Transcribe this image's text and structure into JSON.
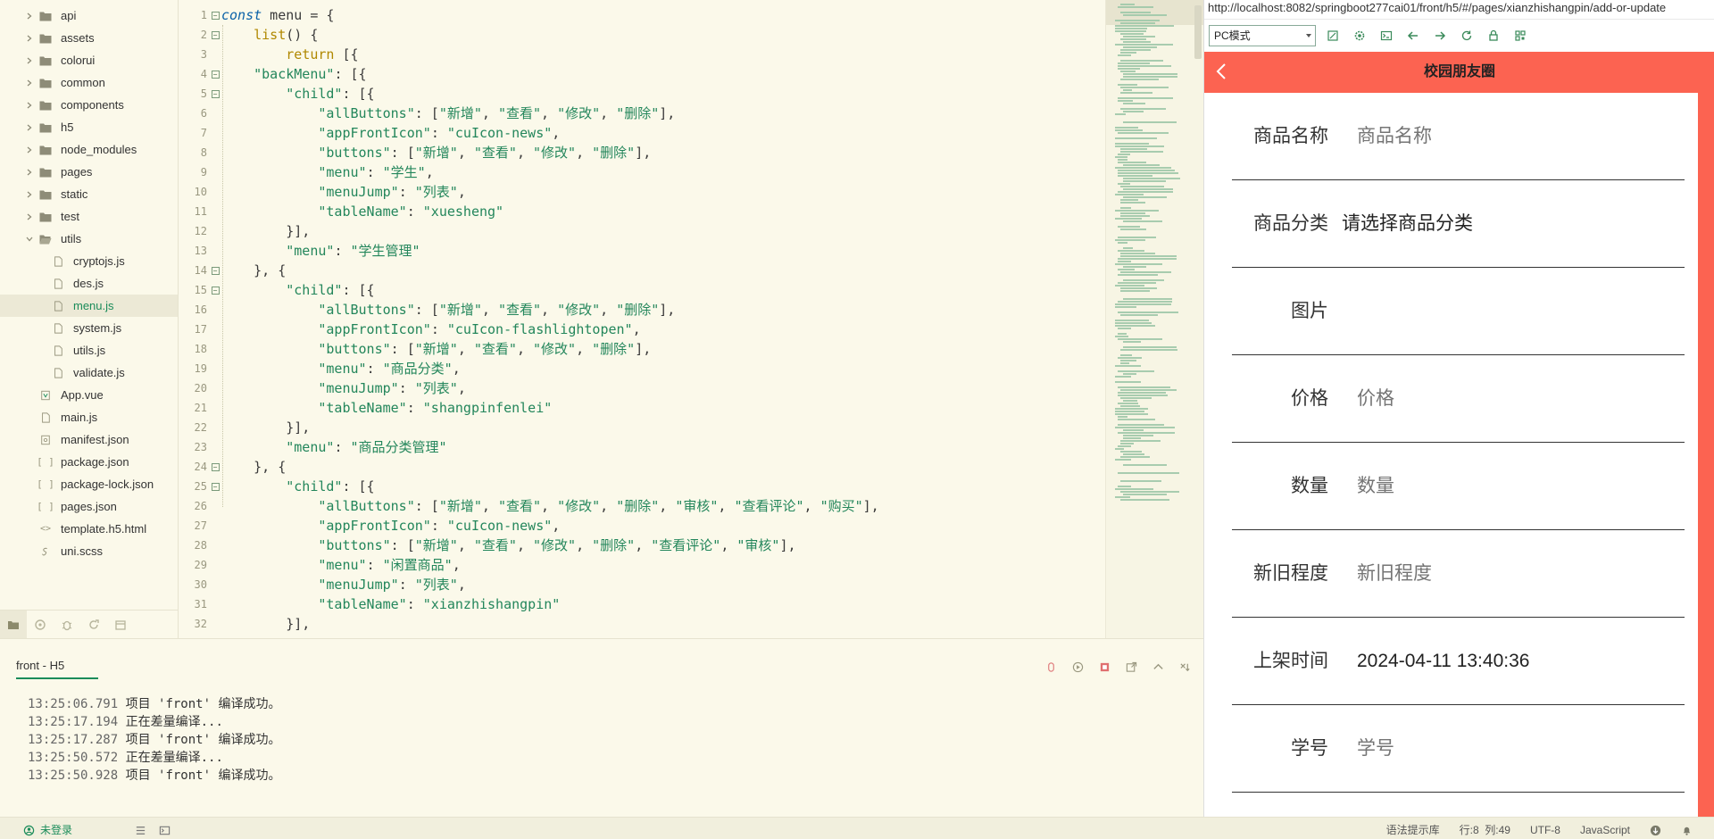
{
  "sidebar": {
    "tree": [
      {
        "label": "api",
        "type": "folder",
        "state": "collapsed",
        "indent": 0
      },
      {
        "label": "assets",
        "type": "folder",
        "state": "collapsed",
        "indent": 0
      },
      {
        "label": "colorui",
        "type": "folder",
        "state": "collapsed",
        "indent": 0
      },
      {
        "label": "common",
        "type": "folder",
        "state": "collapsed",
        "indent": 0
      },
      {
        "label": "components",
        "type": "folder",
        "state": "collapsed",
        "indent": 0
      },
      {
        "label": "h5",
        "type": "folder",
        "state": "collapsed",
        "indent": 0
      },
      {
        "label": "node_modules",
        "type": "folder",
        "state": "collapsed",
        "indent": 0
      },
      {
        "label": "pages",
        "type": "folder",
        "state": "collapsed",
        "indent": 0
      },
      {
        "label": "static",
        "type": "folder",
        "state": "collapsed",
        "indent": 0
      },
      {
        "label": "test",
        "type": "folder",
        "state": "collapsed",
        "indent": 0
      },
      {
        "label": "utils",
        "type": "folder",
        "state": "expanded",
        "indent": 0
      },
      {
        "label": "cryptojs.js",
        "type": "file",
        "indent": 1
      },
      {
        "label": "des.js",
        "type": "file",
        "indent": 1
      },
      {
        "label": "menu.js",
        "type": "file",
        "indent": 1,
        "active": true
      },
      {
        "label": "system.js",
        "type": "file",
        "indent": 1
      },
      {
        "label": "utils.js",
        "type": "file",
        "indent": 1
      },
      {
        "label": "validate.js",
        "type": "file",
        "indent": 1
      },
      {
        "label": "App.vue",
        "type": "vue",
        "indent": 0
      },
      {
        "label": "main.js",
        "type": "file",
        "indent": 0
      },
      {
        "label": "manifest.json",
        "type": "manifest",
        "indent": 0
      },
      {
        "label": "package.json",
        "type": "json",
        "indent": 0
      },
      {
        "label": "package-lock.json",
        "type": "json",
        "indent": 0
      },
      {
        "label": "pages.json",
        "type": "json",
        "indent": 0
      },
      {
        "label": "template.h5.html",
        "type": "html",
        "indent": 0
      },
      {
        "label": "uni.scss",
        "type": "scss",
        "indent": 0
      }
    ],
    "bottom_tabs": [
      "folder-icon",
      "plugin-icon",
      "debug-icon",
      "refresh-icon",
      "package-icon"
    ]
  },
  "editor": {
    "lines": [
      {
        "n": "1",
        "fold": "⊟",
        "tokens": [
          {
            "t": "const",
            "c": "kw"
          },
          {
            "t": " menu = {",
            "c": ""
          }
        ]
      },
      {
        "n": "2",
        "fold": "⊟",
        "tokens": [
          {
            "t": "    ",
            "c": ""
          },
          {
            "t": "list",
            "c": "fn"
          },
          {
            "t": "() {",
            "c": ""
          }
        ]
      },
      {
        "n": "3",
        "fold": "",
        "tokens": [
          {
            "t": "        ",
            "c": ""
          },
          {
            "t": "return",
            "c": "ret"
          },
          {
            "t": " [{",
            "c": ""
          }
        ]
      },
      {
        "n": "4",
        "fold": "⊟",
        "tokens": [
          {
            "t": "    ",
            "c": ""
          },
          {
            "t": "\"backMenu\"",
            "c": "key"
          },
          {
            "t": ": [{",
            "c": ""
          }
        ]
      },
      {
        "n": "5",
        "fold": "⊟",
        "tokens": [
          {
            "t": "        ",
            "c": ""
          },
          {
            "t": "\"child\"",
            "c": "key"
          },
          {
            "t": ": [{",
            "c": ""
          }
        ]
      },
      {
        "n": "6",
        "fold": "",
        "tokens": [
          {
            "t": "            ",
            "c": ""
          },
          {
            "t": "\"allButtons\"",
            "c": "key"
          },
          {
            "t": ": [",
            "c": ""
          },
          {
            "t": "\"新增\"",
            "c": "str"
          },
          {
            "t": ", ",
            "c": ""
          },
          {
            "t": "\"查看\"",
            "c": "str"
          },
          {
            "t": ", ",
            "c": ""
          },
          {
            "t": "\"修改\"",
            "c": "str"
          },
          {
            "t": ", ",
            "c": ""
          },
          {
            "t": "\"删除\"",
            "c": "str"
          },
          {
            "t": "],",
            "c": ""
          }
        ]
      },
      {
        "n": "7",
        "fold": "",
        "tokens": [
          {
            "t": "            ",
            "c": ""
          },
          {
            "t": "\"appFrontIcon\"",
            "c": "key"
          },
          {
            "t": ": ",
            "c": ""
          },
          {
            "t": "\"cuIcon-news\"",
            "c": "str"
          },
          {
            "t": ",",
            "c": ""
          }
        ]
      },
      {
        "n": "8",
        "fold": "",
        "tokens": [
          {
            "t": "            ",
            "c": ""
          },
          {
            "t": "\"buttons\"",
            "c": "key"
          },
          {
            "t": ": [",
            "c": ""
          },
          {
            "t": "\"新增\"",
            "c": "str"
          },
          {
            "t": ", ",
            "c": ""
          },
          {
            "t": "\"查看\"",
            "c": "str"
          },
          {
            "t": ", ",
            "c": ""
          },
          {
            "t": "\"修改\"",
            "c": "str"
          },
          {
            "t": ", ",
            "c": ""
          },
          {
            "t": "\"删除\"",
            "c": "str"
          },
          {
            "t": "],",
            "c": ""
          }
        ]
      },
      {
        "n": "9",
        "fold": "",
        "tokens": [
          {
            "t": "            ",
            "c": ""
          },
          {
            "t": "\"menu\"",
            "c": "key"
          },
          {
            "t": ": ",
            "c": ""
          },
          {
            "t": "\"学生\"",
            "c": "str"
          },
          {
            "t": ",",
            "c": ""
          }
        ]
      },
      {
        "n": "10",
        "fold": "",
        "tokens": [
          {
            "t": "            ",
            "c": ""
          },
          {
            "t": "\"menuJump\"",
            "c": "key"
          },
          {
            "t": ": ",
            "c": ""
          },
          {
            "t": "\"列表\"",
            "c": "str"
          },
          {
            "t": ",",
            "c": ""
          }
        ]
      },
      {
        "n": "11",
        "fold": "",
        "tokens": [
          {
            "t": "            ",
            "c": ""
          },
          {
            "t": "\"tableName\"",
            "c": "key"
          },
          {
            "t": ": ",
            "c": ""
          },
          {
            "t": "\"xuesheng\"",
            "c": "str"
          }
        ]
      },
      {
        "n": "12",
        "fold": "",
        "tokens": [
          {
            "t": "        }],",
            "c": ""
          }
        ]
      },
      {
        "n": "13",
        "fold": "",
        "tokens": [
          {
            "t": "        ",
            "c": ""
          },
          {
            "t": "\"menu\"",
            "c": "key"
          },
          {
            "t": ": ",
            "c": ""
          },
          {
            "t": "\"学生管理\"",
            "c": "str"
          }
        ]
      },
      {
        "n": "14",
        "fold": "⊟",
        "tokens": [
          {
            "t": "    }, {",
            "c": ""
          }
        ]
      },
      {
        "n": "15",
        "fold": "⊟",
        "tokens": [
          {
            "t": "        ",
            "c": ""
          },
          {
            "t": "\"child\"",
            "c": "key"
          },
          {
            "t": ": [{",
            "c": ""
          }
        ]
      },
      {
        "n": "16",
        "fold": "",
        "tokens": [
          {
            "t": "            ",
            "c": ""
          },
          {
            "t": "\"allButtons\"",
            "c": "key"
          },
          {
            "t": ": [",
            "c": ""
          },
          {
            "t": "\"新增\"",
            "c": "str"
          },
          {
            "t": ", ",
            "c": ""
          },
          {
            "t": "\"查看\"",
            "c": "str"
          },
          {
            "t": ", ",
            "c": ""
          },
          {
            "t": "\"修改\"",
            "c": "str"
          },
          {
            "t": ", ",
            "c": ""
          },
          {
            "t": "\"删除\"",
            "c": "str"
          },
          {
            "t": "],",
            "c": ""
          }
        ]
      },
      {
        "n": "17",
        "fold": "",
        "tokens": [
          {
            "t": "            ",
            "c": ""
          },
          {
            "t": "\"appFrontIcon\"",
            "c": "key"
          },
          {
            "t": ": ",
            "c": ""
          },
          {
            "t": "\"cuIcon-flashlightopen\"",
            "c": "str"
          },
          {
            "t": ",",
            "c": ""
          }
        ]
      },
      {
        "n": "18",
        "fold": "",
        "tokens": [
          {
            "t": "            ",
            "c": ""
          },
          {
            "t": "\"buttons\"",
            "c": "key"
          },
          {
            "t": ": [",
            "c": ""
          },
          {
            "t": "\"新增\"",
            "c": "str"
          },
          {
            "t": ", ",
            "c": ""
          },
          {
            "t": "\"查看\"",
            "c": "str"
          },
          {
            "t": ", ",
            "c": ""
          },
          {
            "t": "\"修改\"",
            "c": "str"
          },
          {
            "t": ", ",
            "c": ""
          },
          {
            "t": "\"删除\"",
            "c": "str"
          },
          {
            "t": "],",
            "c": ""
          }
        ]
      },
      {
        "n": "19",
        "fold": "",
        "tokens": [
          {
            "t": "            ",
            "c": ""
          },
          {
            "t": "\"menu\"",
            "c": "key"
          },
          {
            "t": ": ",
            "c": ""
          },
          {
            "t": "\"商品分类\"",
            "c": "str"
          },
          {
            "t": ",",
            "c": ""
          }
        ]
      },
      {
        "n": "20",
        "fold": "",
        "tokens": [
          {
            "t": "            ",
            "c": ""
          },
          {
            "t": "\"menuJump\"",
            "c": "key"
          },
          {
            "t": ": ",
            "c": ""
          },
          {
            "t": "\"列表\"",
            "c": "str"
          },
          {
            "t": ",",
            "c": ""
          }
        ]
      },
      {
        "n": "21",
        "fold": "",
        "tokens": [
          {
            "t": "            ",
            "c": ""
          },
          {
            "t": "\"tableName\"",
            "c": "key"
          },
          {
            "t": ": ",
            "c": ""
          },
          {
            "t": "\"shangpinfenlei\"",
            "c": "str"
          }
        ]
      },
      {
        "n": "22",
        "fold": "",
        "tokens": [
          {
            "t": "        }],",
            "c": ""
          }
        ]
      },
      {
        "n": "23",
        "fold": "",
        "tokens": [
          {
            "t": "        ",
            "c": ""
          },
          {
            "t": "\"menu\"",
            "c": "key"
          },
          {
            "t": ": ",
            "c": ""
          },
          {
            "t": "\"商品分类管理\"",
            "c": "str"
          }
        ]
      },
      {
        "n": "24",
        "fold": "⊟",
        "tokens": [
          {
            "t": "    }, {",
            "c": ""
          }
        ]
      },
      {
        "n": "25",
        "fold": "⊟",
        "tokens": [
          {
            "t": "        ",
            "c": ""
          },
          {
            "t": "\"child\"",
            "c": "key"
          },
          {
            "t": ": [{",
            "c": ""
          }
        ]
      },
      {
        "n": "26",
        "fold": "",
        "tokens": [
          {
            "t": "            ",
            "c": ""
          },
          {
            "t": "\"allButtons\"",
            "c": "key"
          },
          {
            "t": ": [",
            "c": ""
          },
          {
            "t": "\"新增\"",
            "c": "str"
          },
          {
            "t": ", ",
            "c": ""
          },
          {
            "t": "\"查看\"",
            "c": "str"
          },
          {
            "t": ", ",
            "c": ""
          },
          {
            "t": "\"修改\"",
            "c": "str"
          },
          {
            "t": ", ",
            "c": ""
          },
          {
            "t": "\"删除\"",
            "c": "str"
          },
          {
            "t": ", ",
            "c": ""
          },
          {
            "t": "\"审核\"",
            "c": "str"
          },
          {
            "t": ", ",
            "c": ""
          },
          {
            "t": "\"查看评论\"",
            "c": "str"
          },
          {
            "t": ", ",
            "c": ""
          },
          {
            "t": "\"购买\"",
            "c": "str"
          },
          {
            "t": "],",
            "c": ""
          }
        ]
      },
      {
        "n": "27",
        "fold": "",
        "tokens": [
          {
            "t": "            ",
            "c": ""
          },
          {
            "t": "\"appFrontIcon\"",
            "c": "key"
          },
          {
            "t": ": ",
            "c": ""
          },
          {
            "t": "\"cuIcon-news\"",
            "c": "str"
          },
          {
            "t": ",",
            "c": ""
          }
        ]
      },
      {
        "n": "28",
        "fold": "",
        "tokens": [
          {
            "t": "            ",
            "c": ""
          },
          {
            "t": "\"buttons\"",
            "c": "key"
          },
          {
            "t": ": [",
            "c": ""
          },
          {
            "t": "\"新增\"",
            "c": "str"
          },
          {
            "t": ", ",
            "c": ""
          },
          {
            "t": "\"查看\"",
            "c": "str"
          },
          {
            "t": ", ",
            "c": ""
          },
          {
            "t": "\"修改\"",
            "c": "str"
          },
          {
            "t": ", ",
            "c": ""
          },
          {
            "t": "\"删除\"",
            "c": "str"
          },
          {
            "t": ", ",
            "c": ""
          },
          {
            "t": "\"查看评论\"",
            "c": "str"
          },
          {
            "t": ", ",
            "c": ""
          },
          {
            "t": "\"审核\"",
            "c": "str"
          },
          {
            "t": "],",
            "c": ""
          }
        ]
      },
      {
        "n": "29",
        "fold": "",
        "tokens": [
          {
            "t": "            ",
            "c": ""
          },
          {
            "t": "\"menu\"",
            "c": "key"
          },
          {
            "t": ": ",
            "c": ""
          },
          {
            "t": "\"闲置商品\"",
            "c": "str"
          },
          {
            "t": ",",
            "c": ""
          }
        ]
      },
      {
        "n": "30",
        "fold": "",
        "tokens": [
          {
            "t": "            ",
            "c": ""
          },
          {
            "t": "\"menuJump\"",
            "c": "key"
          },
          {
            "t": ": ",
            "c": ""
          },
          {
            "t": "\"列表\"",
            "c": "str"
          },
          {
            "t": ",",
            "c": ""
          }
        ]
      },
      {
        "n": "31",
        "fold": "",
        "tokens": [
          {
            "t": "            ",
            "c": ""
          },
          {
            "t": "\"tableName\"",
            "c": "key"
          },
          {
            "t": ": ",
            "c": ""
          },
          {
            "t": "\"xianzhishangpin\"",
            "c": "str"
          }
        ]
      },
      {
        "n": "32",
        "fold": "",
        "tokens": [
          {
            "t": "        }],",
            "c": ""
          }
        ]
      }
    ]
  },
  "console": {
    "tab_label": "front - H5",
    "tools": [
      "stop-icon",
      "run-icon",
      "square-stop-icon",
      "open-external-icon",
      "chevron-up-icon",
      "clear-icon"
    ],
    "log": [
      {
        "time": "13:25:06.791",
        "msg": "项目 'front' 编译成功。"
      },
      {
        "time": "13:25:17.194",
        "msg": "正在差量编译..."
      },
      {
        "time": "13:25:17.287",
        "msg": "项目 'front' 编译成功。"
      },
      {
        "time": "13:25:50.572",
        "msg": "正在差量编译..."
      },
      {
        "time": "13:25:50.928",
        "msg": "项目 'front' 编译成功。"
      }
    ]
  },
  "statusbar": {
    "login": "未登录",
    "syntax_hint": "语法提示库",
    "position": "行:8  列:49",
    "encoding": "UTF-8",
    "language": "JavaScript"
  },
  "preview": {
    "url": "http://localhost:8082/springboot277cai01/front/h5/#/pages/xianzhishangpin/add-or-update",
    "mode": "PC模式",
    "page_title": "校园朋友圈",
    "accent_color": "#fc6351",
    "fields": [
      {
        "label": "商品名称",
        "placeholder": "商品名称",
        "value": "",
        "kind": "input"
      },
      {
        "label": "商品分类",
        "placeholder": "",
        "value": "请选择商品分类",
        "kind": "select"
      },
      {
        "label": "图片",
        "placeholder": "",
        "value": "",
        "kind": "image"
      },
      {
        "label": "价格",
        "placeholder": "价格",
        "value": "",
        "kind": "input"
      },
      {
        "label": "数量",
        "placeholder": "数量",
        "value": "",
        "kind": "input"
      },
      {
        "label": "新旧程度",
        "placeholder": "新旧程度",
        "value": "",
        "kind": "input"
      },
      {
        "label": "上架时间",
        "placeholder": "",
        "value": "2024-04-11 13:40:36",
        "kind": "datetime"
      },
      {
        "label": "学号",
        "placeholder": "学号",
        "value": "",
        "kind": "input"
      }
    ]
  }
}
